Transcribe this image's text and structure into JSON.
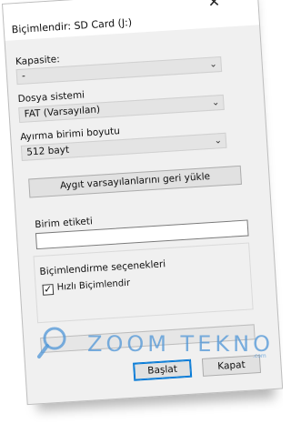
{
  "dialog": {
    "title": "Biçimlendir: SD Card (J:)",
    "close_glyph": "✕"
  },
  "capacity": {
    "label": "Kapasite:",
    "value": "-"
  },
  "filesystem": {
    "label": "Dosya sistemi",
    "value": "FAT (Varsayılan)"
  },
  "allocation": {
    "label": "Ayırma birimi boyutu",
    "value": "512 bayt"
  },
  "restore_button": "Aygıt varsayılanlarını geri yükle",
  "volume_label": {
    "label": "Birim etiketi",
    "value": ""
  },
  "format_options": {
    "label": "Biçimlendirme seçenekleri",
    "quick_format_label": "Hızlı Biçimlendir",
    "quick_format_checked": true,
    "check_glyph": "✓"
  },
  "buttons": {
    "start": "Başlat",
    "close": "Kapat"
  },
  "watermark": {
    "text": "ZOOM TEKNO",
    "suffix": ".com"
  },
  "icons": {
    "dropdown": "chevron-down-icon",
    "close": "close-icon",
    "check": "checkmark-icon",
    "watermark": "magnifier-icon"
  },
  "colors": {
    "dialog_bg": "#f0f0f0",
    "accent": "#0078d7",
    "watermark": "#4f96d7"
  }
}
